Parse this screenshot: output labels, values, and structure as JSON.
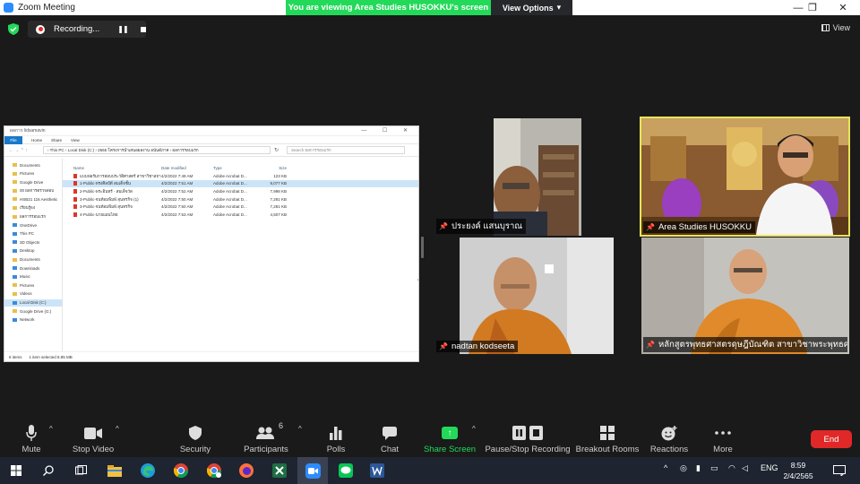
{
  "window": {
    "title": "Zoom Meeting",
    "controls": [
      "—",
      "❐",
      "✕"
    ]
  },
  "share_banner": {
    "viewing_text": "You are viewing Area Studies HUSOKKU's screen",
    "view_options_label": "View Options",
    "view_options_caret": "▾"
  },
  "recording": {
    "label": "Recording...",
    "pause_glyph": "❚❚"
  },
  "view": {
    "label": "View"
  },
  "explorer": {
    "title": "ผลการ lidsamavin",
    "controls": "— ☐ ✕",
    "ribbon": {
      "file": "File",
      "tabs": [
        "Home",
        "Share",
        "View"
      ]
    },
    "nav": "← → ⌃ ↑",
    "address": "› This PC  ›  Local Disk (C:)  ›  2565 โครงการนำเสนอผลงาน อนันต์ภาค  ›  ผลการรอบแรก",
    "refresh": "↻",
    "search_placeholder": "Search ผลการรอบแรก",
    "sidebar": [
      {
        "label": "Documents",
        "kind": "folder"
      },
      {
        "label": "Pictures",
        "kind": "folder"
      },
      {
        "label": "Google Drive",
        "kind": "folder"
      },
      {
        "label": "00 ผลการตรวจสอบ",
        "kind": "folder"
      },
      {
        "label": "HSB21 116 Aesthetic",
        "kind": "folder"
      },
      {
        "label": "เรียนรู้64",
        "kind": "folder"
      },
      {
        "label": "ผลการรอบแรก",
        "kind": "folder"
      },
      {
        "label": "OneDrive",
        "kind": "blue"
      },
      {
        "label": "This PC",
        "kind": "blue"
      },
      {
        "label": "3D Objects",
        "kind": "blue"
      },
      {
        "label": "Desktop",
        "kind": "blue"
      },
      {
        "label": "Documents",
        "kind": "folder"
      },
      {
        "label": "Downloads",
        "kind": "blue"
      },
      {
        "label": "Music",
        "kind": "blue"
      },
      {
        "label": "Pictures",
        "kind": "folder"
      },
      {
        "label": "Videos",
        "kind": "folder"
      },
      {
        "label": "Local Disk (C:)",
        "kind": "blue",
        "selected": true
      },
      {
        "label": "Google Drive (G:)",
        "kind": "folder"
      },
      {
        "label": "Network",
        "kind": "blue"
      }
    ],
    "columns": [
      "Name",
      "Date modified",
      "Type",
      "Size"
    ],
    "files": [
      {
        "name": "แบบฟอร์มการสอบประวัติศาสตร์ สาขาวิชาสถานศึกษา...",
        "date": "4/2/2022 7:49 AM",
        "type": "Adobe Acrobat D...",
        "size": "123 KB",
        "selected": false
      },
      {
        "name": "1-Public-ทรงศิลป์ดี สมเด็จชั้น",
        "date": "4/2/2022 7:51 AM",
        "type": "Adobe Acrobat D...",
        "size": "9,077 KB",
        "selected": true
      },
      {
        "name": "2-Public-พระอินทร์ - สมเด็จวัด",
        "date": "4/2/2022 7:52 AM",
        "type": "Adobe Acrobat D...",
        "size": "7,998 KB",
        "selected": false
      },
      {
        "name": "3-Public-จนท้อมพิมพ์ สุนทรกิจ (1)",
        "date": "4/2/2022 7:50 AM",
        "type": "Adobe Acrobat D...",
        "size": "7,281 KB",
        "selected": false
      },
      {
        "name": "3-Public-จนท้อมพิมพ์ สุนทรกิจ",
        "date": "4/2/2022 7:50 AM",
        "type": "Adobe Acrobat D...",
        "size": "7,281 KB",
        "selected": false
      },
      {
        "name": "4-Public-นายแผนไทย",
        "date": "4/2/2022 7:53 AM",
        "type": "Adobe Acrobat D...",
        "size": "4,507 KB",
        "selected": false
      }
    ],
    "status": [
      "6 items",
      "1 item selected  8.85 MB"
    ]
  },
  "participants": [
    {
      "name": "ประยงค์ แสนบุราณ",
      "pinned": true,
      "active": false,
      "bg": "#8a8a80"
    },
    {
      "name": "Area Studies HUSOKKU",
      "pinned": true,
      "active": true,
      "bg": "#9a6a3a"
    },
    {
      "name": "nadtan kodseeta",
      "pinned": true,
      "active": false,
      "bg": "#c9c9c9"
    },
    {
      "name": "หลักสูตรพุทธศาสตรดุษฎีบัณฑิต สาขาวิชาพระพุทธศา...",
      "pinned": true,
      "active": false,
      "bg": "#bfbcb5"
    }
  ],
  "toolbar": {
    "mute": "Mute",
    "stop_video": "Stop Video",
    "security": "Security",
    "participants": "Participants",
    "participants_count": "6",
    "polls": "Polls",
    "chat": "Chat",
    "share_screen": "Share Screen",
    "pause_stop_recording": "Pause/Stop Recording",
    "breakout_rooms": "Breakout Rooms",
    "reactions": "Reactions",
    "more": "More",
    "end": "End"
  },
  "taskbar": {
    "language": "ENG",
    "time": "8:59",
    "date": "2/4/2565"
  },
  "colors": {
    "accent_green": "#23d959",
    "end_red": "#e02828",
    "active_speaker": "#e8e35b",
    "zoom_blue": "#2d8cff"
  }
}
